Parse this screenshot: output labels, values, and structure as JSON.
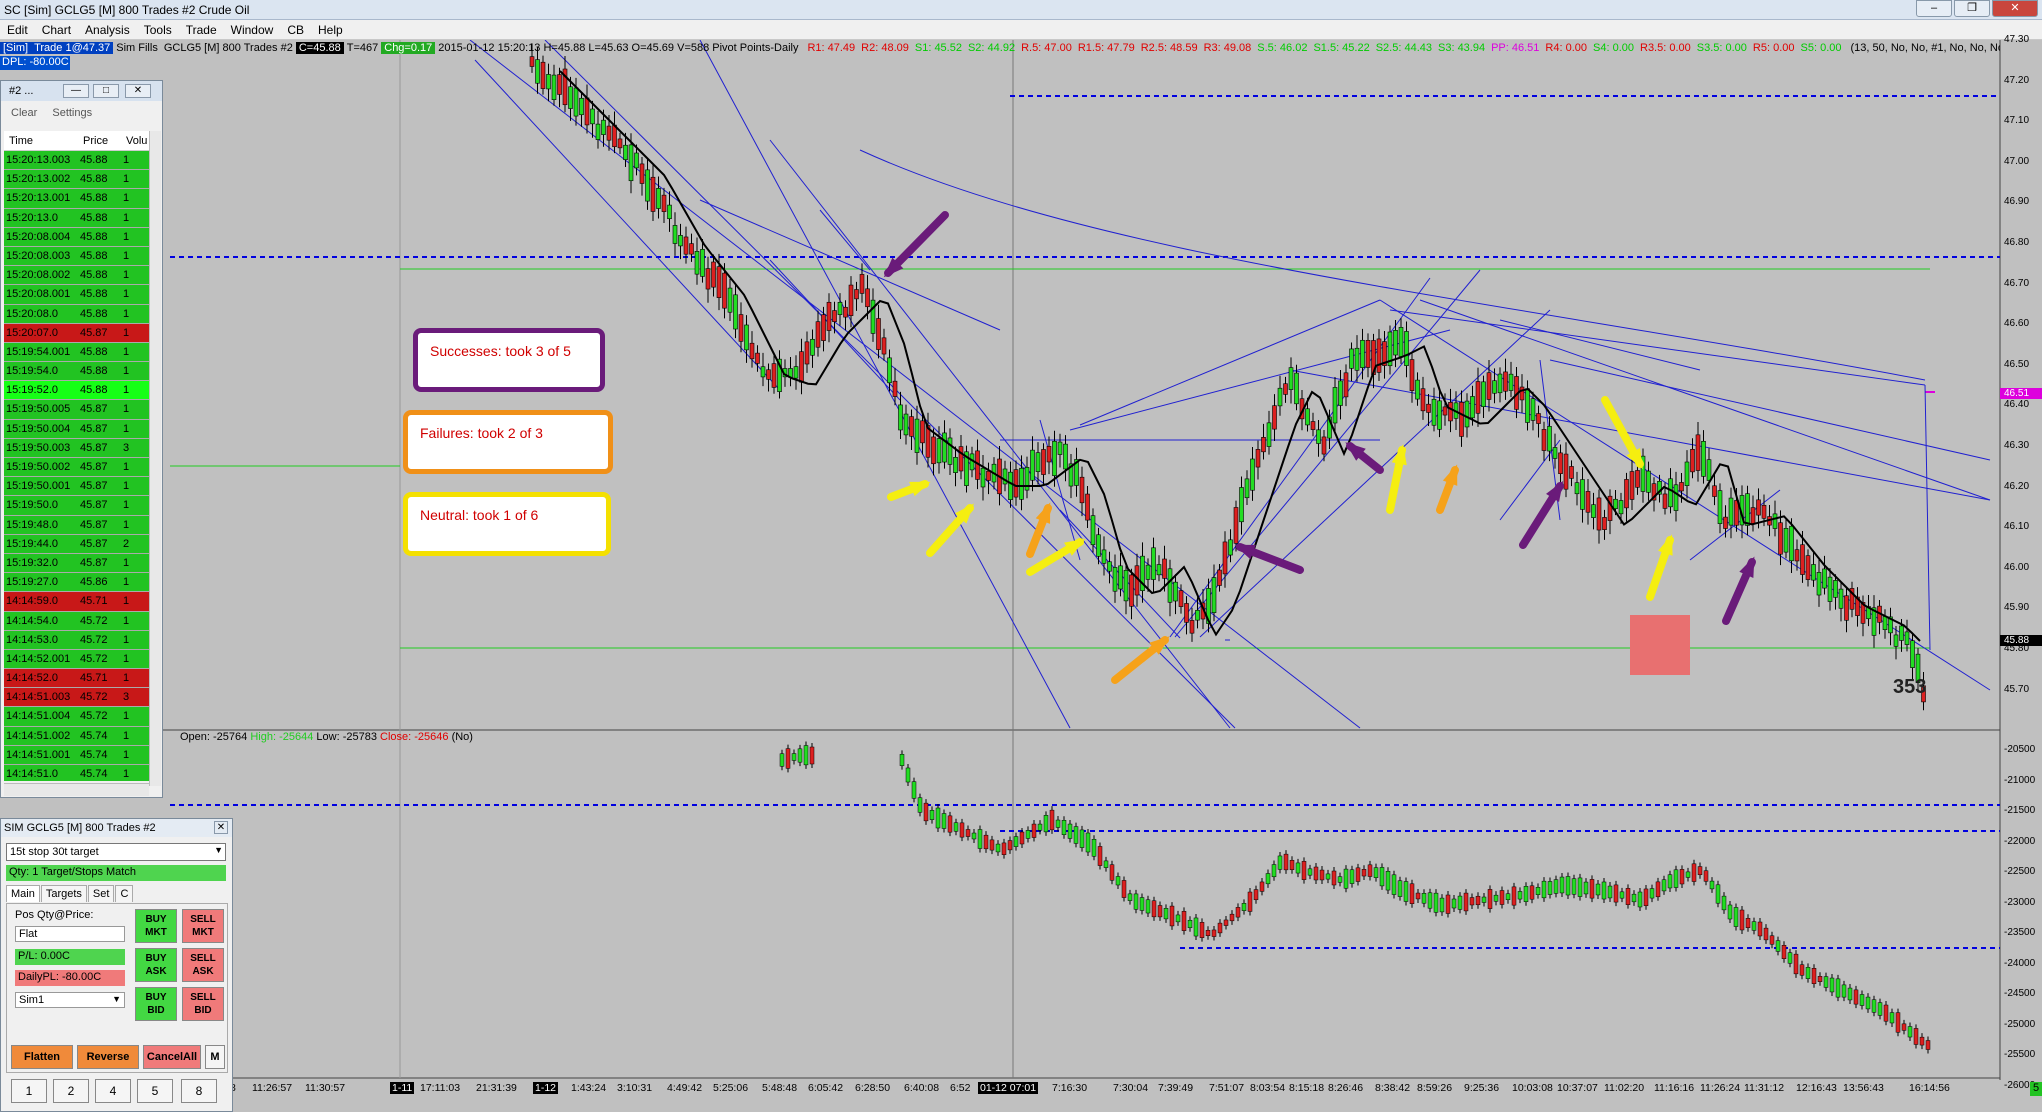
{
  "window": {
    "title": "SC [Sim] GCLG5 [M]  800 Trades  #2  Crude Oil",
    "buttons": [
      "–",
      "❐",
      "✕"
    ]
  },
  "menu": [
    "Edit",
    "Chart",
    "Analysis",
    "Tools",
    "Trade",
    "Window",
    "CB",
    "Help"
  ],
  "infobar": {
    "tag": "[Sim]",
    "trade": "Trade 1@47.37",
    "fills": "Sim Fills",
    "symbol": "GCLG5 [M]  800 Trades  #2",
    "close": "C=45.88",
    "t": "T=467",
    "chg": "Chg=0.17",
    "bar": "2015-01-12 15:20:13 H=45.88 L=45.63 O=45.69 V=588 Pivot Points-Daily",
    "pivots": [
      {
        "t": "R1: 47.49",
        "c": "#e00000"
      },
      {
        "t": "R2: 48.09",
        "c": "#e00000"
      },
      {
        "t": "S1: 45.52",
        "c": "#00cc00"
      },
      {
        "t": "S2: 44.92",
        "c": "#00cc00"
      },
      {
        "t": "R.5: 47.00",
        "c": "#e00000"
      },
      {
        "t": "R1.5: 47.79",
        "c": "#e00000"
      },
      {
        "t": "R2.5: 48.59",
        "c": "#e00000"
      },
      {
        "t": "R3: 49.08",
        "c": "#e00000"
      },
      {
        "t": "S.5: 46.02",
        "c": "#00cc00"
      },
      {
        "t": "S1.5: 45.22",
        "c": "#00cc00"
      },
      {
        "t": "S2.5: 44.43",
        "c": "#00cc00"
      },
      {
        "t": "S3: 43.94",
        "c": "#00cc00"
      },
      {
        "t": "PP: 46.51",
        "c": "#dd00dd"
      },
      {
        "t": "R4: 0.00",
        "c": "#e00000"
      },
      {
        "t": "S4: 0.00",
        "c": "#00cc00"
      },
      {
        "t": "R3.5: 0.00",
        "c": "#e00000"
      },
      {
        "t": "S3.5: 0.00",
        "c": "#00cc00"
      },
      {
        "t": "R5: 0.00",
        "c": "#e00000"
      },
      {
        "t": "S5: 0.00",
        "c": "#00cc00"
      }
    ],
    "tail": "(13, 50, No, No, #1, No, No, No,",
    "dpl": "DPL: -80.00C"
  },
  "timesales": {
    "title": "#2 ...",
    "tools": [
      "Clear",
      "Settings"
    ],
    "headers": [
      "Time",
      "Price",
      "Volu"
    ],
    "rows": [
      [
        "15:20:13.003",
        "45.88",
        "1",
        "g"
      ],
      [
        "15:20:13.002",
        "45.88",
        "1",
        "g"
      ],
      [
        "15:20:13.001",
        "45.88",
        "1",
        "g"
      ],
      [
        "15:20:13.0",
        "45.88",
        "1",
        "g"
      ],
      [
        "15:20:08.004",
        "45.88",
        "1",
        "g"
      ],
      [
        "15:20:08.003",
        "45.88",
        "1",
        "g"
      ],
      [
        "15:20:08.002",
        "45.88",
        "1",
        "g"
      ],
      [
        "15:20:08.001",
        "45.88",
        "1",
        "g"
      ],
      [
        "15:20:08.0",
        "45.88",
        "1",
        "g"
      ],
      [
        "15:20:07.0",
        "45.87",
        "1",
        "r"
      ],
      [
        "15:19:54.001",
        "45.88",
        "1",
        "g"
      ],
      [
        "15:19:54.0",
        "45.88",
        "1",
        "g"
      ],
      [
        "15:19:52.0",
        "45.88",
        "1",
        "bg"
      ],
      [
        "15:19:50.005",
        "45.87",
        "1",
        "g"
      ],
      [
        "15:19:50.004",
        "45.87",
        "1",
        "g"
      ],
      [
        "15:19:50.003",
        "45.87",
        "3",
        "g"
      ],
      [
        "15:19:50.002",
        "45.87",
        "1",
        "g"
      ],
      [
        "15:19:50.001",
        "45.87",
        "1",
        "g"
      ],
      [
        "15:19:50.0",
        "45.87",
        "1",
        "g"
      ],
      [
        "15:19:48.0",
        "45.87",
        "1",
        "g"
      ],
      [
        "15:19:44.0",
        "45.87",
        "2",
        "g"
      ],
      [
        "15:19:32.0",
        "45.87",
        "1",
        "g"
      ],
      [
        "15:19:27.0",
        "45.86",
        "1",
        "g"
      ],
      [
        "14:14:59.0",
        "45.71",
        "1",
        "r"
      ],
      [
        "14:14:54.0",
        "45.72",
        "1",
        "g"
      ],
      [
        "14:14:53.0",
        "45.72",
        "1",
        "g"
      ],
      [
        "14:14:52.001",
        "45.72",
        "1",
        "g"
      ],
      [
        "14:14:52.0",
        "45.71",
        "1",
        "r"
      ],
      [
        "14:14:51.003",
        "45.72",
        "3",
        "r"
      ],
      [
        "14:14:51.004",
        "45.72",
        "1",
        "g"
      ],
      [
        "14:14:51.002",
        "45.74",
        "1",
        "g"
      ],
      [
        "14:14:51.001",
        "45.74",
        "1",
        "g"
      ],
      [
        "14:14:51.0",
        "45.74",
        "1",
        "g"
      ]
    ]
  },
  "trade": {
    "title": "SIM GCLG5 [M]  800 Trades  #2",
    "strategy": "15t stop 30t target",
    "qty": "Qty: 1 Target/Stops Match",
    "tabs": [
      "Main",
      "Targets",
      "Set",
      "C"
    ],
    "pos_label": "Pos Qty@Price:",
    "pos": "Flat",
    "pl": "P/L: 0.00C",
    "daily": "DailyPL: -80.00C",
    "account": "Sim1",
    "buy": [
      "BUY MKT",
      "BUY ASK",
      "BUY BID"
    ],
    "sell": [
      "SELL MKT",
      "SELL ASK",
      "SELL BID"
    ],
    "flatten": "Flatten",
    "reverse": "Reverse",
    "cancel": "CancelAll",
    "m": "M",
    "qtys": [
      "1",
      "2",
      "4",
      "5",
      "8"
    ]
  },
  "notes": {
    "success": "Successes: took 3 of 5",
    "failure": "Failures: took 2 of 3",
    "neutral": "Neutral: took 1 of 6"
  },
  "subgraph": {
    "open": "Open: -25764",
    "high": "High: -25644",
    "low": "Low: -25783",
    "close": "Close: -25646",
    "flag": "(No)"
  },
  "price_axis": [
    "47.30",
    "47.20",
    "47.10",
    "47.00",
    "46.90",
    "46.80",
    "46.70",
    "46.60",
    "46.50",
    "46.40",
    "46.30",
    "46.20",
    "46.10",
    "46.00",
    "45.90",
    "45.80",
    "45.70"
  ],
  "price_tags": [
    {
      "t": "46.51",
      "c": "#dd00dd"
    },
    {
      "t": "45.88",
      "c": "#000000"
    }
  ],
  "sub_axis": [
    "-20500",
    "-21000",
    "-21500",
    "-22000",
    "-22500",
    "-23000",
    "-23500",
    "-24000",
    "-24500",
    "-25000",
    "-25500",
    "-26000"
  ],
  "time_axis": [
    "8",
    "11:26:57",
    "11:30:57",
    "1-11",
    "17:11:03",
    "21:31:39",
    "1-12",
    "1:43:24",
    "3:10:31",
    "4:49:42",
    "5:25:06",
    "5:48:48",
    "6:05:42",
    "6:28:50",
    "6:40:08",
    "6:52",
    "01-12 07:01",
    "7:16:30",
    "7:30:04",
    "7:39:49",
    "7:51:07",
    "8:03:54",
    "8:15:18",
    "8:26:46",
    "8:38:42",
    "8:59:26",
    "9:25:36",
    "10:03:08",
    "10:37:07",
    "11:02:20",
    "11:16:16",
    "11:26:24",
    "11:31:12",
    "12:16:43",
    "13:56:43",
    "16:14:56"
  ],
  "count_label": "353",
  "corner": "5"
}
